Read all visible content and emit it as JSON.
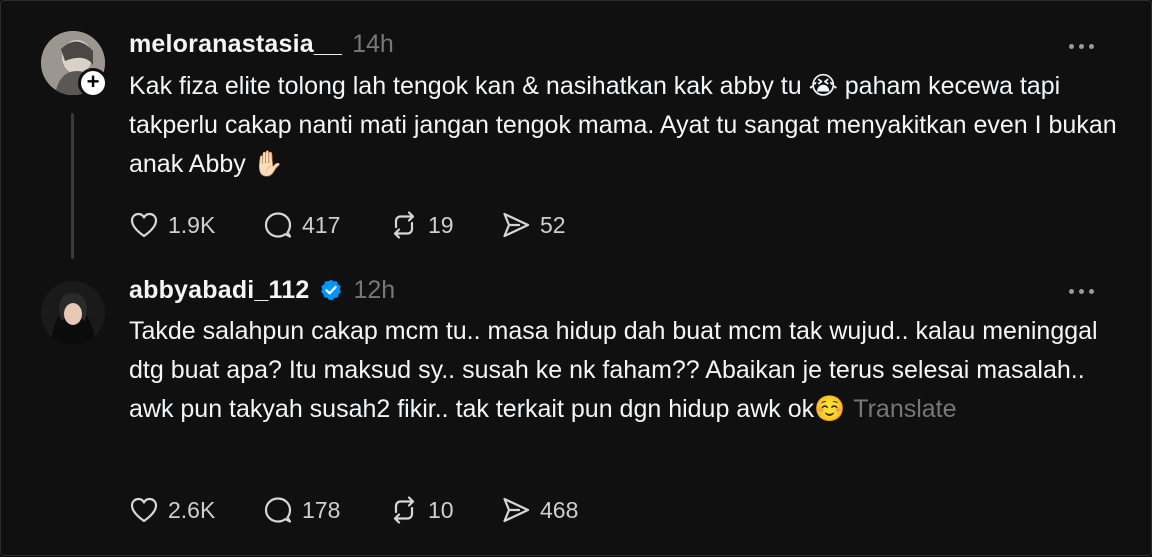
{
  "posts": [
    {
      "username": "meloranastasia__",
      "time": "14h",
      "verified": false,
      "text": "Kak fiza elite tolong lah tengok kan & nasihatkan kak abby tu 😭 paham kecewa tapi takperlu cakap nanti mati jangan tengok mama. Ayat tu sangat menyakitkan even I bukan anak Abby ✋🏻",
      "translate": "",
      "likes": "1.9K",
      "replies": "417",
      "reposts": "19",
      "shares": "52"
    },
    {
      "username": "abbyabadi_112",
      "time": "12h",
      "verified": true,
      "text": "Takde salahpun cakap mcm tu.. masa hidup dah buat mcm tak wujud.. kalau meninggal dtg buat apa? Itu maksud sy.. susah ke nk faham?? Abaikan je terus selesai masalah.. awk pun takyah susah2 fikir.. tak terkait pun dgn hidup awk ok☺️",
      "translate": "Translate",
      "likes": "2.6K",
      "replies": "178",
      "reposts": "10",
      "shares": "468"
    }
  ],
  "colors": {
    "background": "#101010",
    "text": "#f3f5f7",
    "muted": "#777777",
    "verified": "#0095f6"
  },
  "icons": [
    "plus-icon",
    "more-icon",
    "verified-icon",
    "heart-icon",
    "reply-icon",
    "repost-icon",
    "share-icon"
  ]
}
